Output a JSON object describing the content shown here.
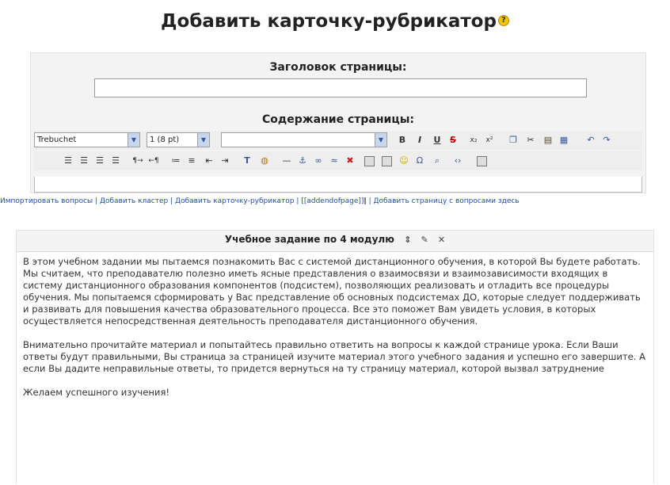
{
  "page": {
    "title": "Добавить карточку-рубрикатор",
    "help_icon": "?"
  },
  "form": {
    "title_label": "Заголовок страницы:",
    "content_label": "Содержание страницы:",
    "title_value": ""
  },
  "toolbar": {
    "font_family": "Trebuchet",
    "font_size": "1 (8 pt)",
    "format": "",
    "buttons_row1": [
      "B",
      "I",
      "U",
      "S",
      "x₂",
      "x²",
      "copy",
      "cut",
      "paste",
      "paste-word",
      "undo",
      "redo"
    ],
    "buttons_row2": [
      "align-left",
      "align-center",
      "align-right",
      "align-justify",
      "ltr",
      "rtl",
      "ordered-list",
      "unordered-list",
      "outdent",
      "indent",
      "text-color",
      "bg-color",
      "hr",
      "anchor",
      "link",
      "unlink",
      "unlink-all",
      "image",
      "table",
      "smiley",
      "special-char",
      "search",
      "html-source",
      "fullscreen"
    ]
  },
  "links": {
    "items": [
      "Импортировать вопросы",
      "Добавить кластер",
      "Добавить карточку-рубрикатор",
      "[[addendofpage]]",
      "Добавить страницу с вопросами здесь"
    ]
  },
  "lesson": {
    "title": "Учебное задание по 4 модулю",
    "paragraph1": "В этом учебном задании мы пытаемся познакомить Вас с системой дистанционного обучения, в которой Вы будете работать. Мы считаем, что преподавателю полезно иметь ясные представления о взаимосвязи и взаимозависимости входящих в систему дистанционного образования компонентов (подсистем), позволяющих реализовать и отладить все процедуры обучения. Мы попытаемся сформировать у Вас представление об основных подсистемах ДО, которые следует поддерживать и развивать для повышения качества образовательного процесса. Все это поможет Вам увидеть условия, в которых осуществляется непосредственная деятельность преподавателя дистанционного обучения.",
    "paragraph2": "Внимательно прочитайте материал и попытайтесь правильно ответить на вопросы к каждой странице урока. Если Ваши ответы будут правильными, Вы страница за страницей изучите материал этого учебного задания и успешно его завершите. А если Вы дадите неправильные ответы, то придется вернуться на ту страницу материал, которой вызвал затруднение",
    "paragraph3": "Желаем успешного изучения!"
  },
  "colors": {
    "link": "#1f4fb3",
    "panel": "#f3f3f3",
    "help_icon": "#f1c40f"
  }
}
